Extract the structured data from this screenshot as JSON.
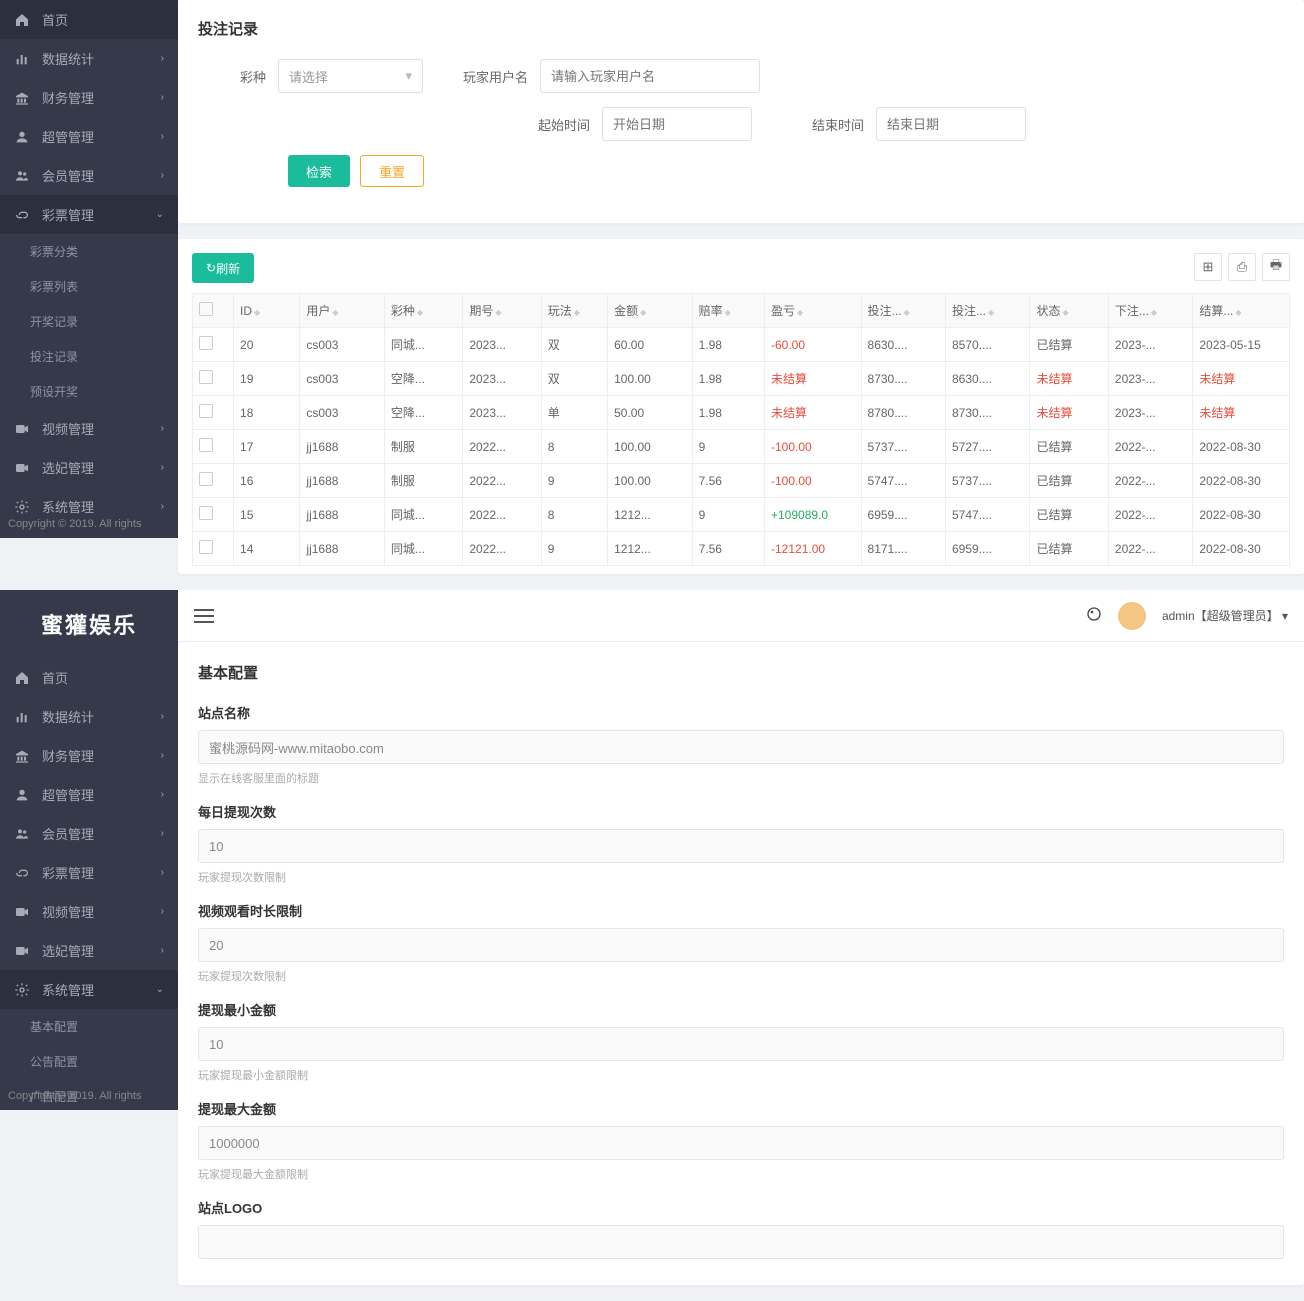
{
  "brand": "蜜獾娱乐",
  "copyright": "Copyright © 2019. All rights",
  "sidebar1": {
    "items": [
      {
        "label": "首页",
        "icon": "home",
        "expand": false
      },
      {
        "label": "数据统计",
        "icon": "bars",
        "expand": true
      },
      {
        "label": "财务管理",
        "icon": "bank",
        "expand": true
      },
      {
        "label": "超管管理",
        "icon": "user",
        "expand": true
      },
      {
        "label": "会员管理",
        "icon": "users",
        "expand": true
      },
      {
        "label": "彩票管理",
        "icon": "link",
        "expand": true,
        "open": true,
        "subs": [
          "彩票分类",
          "彩票列表",
          "开奖记录",
          "投注记录",
          "预设开奖"
        ]
      },
      {
        "label": "视频管理",
        "icon": "video",
        "expand": true
      },
      {
        "label": "选妃管理",
        "icon": "video",
        "expand": true
      },
      {
        "label": "系统管理",
        "icon": "gear",
        "expand": true
      }
    ]
  },
  "sidebar2": {
    "items": [
      {
        "label": "首页",
        "icon": "home",
        "expand": false
      },
      {
        "label": "数据统计",
        "icon": "bars",
        "expand": true
      },
      {
        "label": "财务管理",
        "icon": "bank",
        "expand": true
      },
      {
        "label": "超管管理",
        "icon": "user",
        "expand": true
      },
      {
        "label": "会员管理",
        "icon": "users",
        "expand": true
      },
      {
        "label": "彩票管理",
        "icon": "link",
        "expand": true
      },
      {
        "label": "视频管理",
        "icon": "video",
        "expand": true
      },
      {
        "label": "选妃管理",
        "icon": "video",
        "expand": true
      },
      {
        "label": "系统管理",
        "icon": "gear",
        "expand": true,
        "open": true,
        "subs": [
          "基本配置",
          "公告配置",
          "广告配置"
        ]
      }
    ]
  },
  "betting": {
    "title": "投注记录",
    "labels": {
      "type": "彩种",
      "typePlaceholder": "请选择",
      "user": "玩家用户名",
      "userPlaceholder": "请输入玩家用户名",
      "start": "起始时间",
      "startPlaceholder": "开始日期",
      "end": "结束时间",
      "endPlaceholder": "结束日期"
    },
    "btnSearch": "检索",
    "btnReset": "重置",
    "btnRefresh": "刷新",
    "columns": [
      "",
      "ID",
      "用户",
      "彩种",
      "期号",
      "玩法",
      "金额",
      "赔率",
      "盈亏",
      "投注...",
      "投注...",
      "状态",
      "下注...",
      "结算..."
    ],
    "rows": [
      {
        "id": "20",
        "user": "cs003",
        "type": "同城...",
        "period": "2023...",
        "play": "双",
        "amount": "60.00",
        "odds": "1.98",
        "profit": "-60.00",
        "bet1": "8630....",
        "bet2": "8570....",
        "status": "已结算",
        "time1": "2023-...",
        "time2": "2023-05-15"
      },
      {
        "id": "19",
        "user": "cs003",
        "type": "空降...",
        "period": "2023...",
        "play": "双",
        "amount": "100.00",
        "odds": "1.98",
        "profit": "未结算",
        "bet1": "8730....",
        "bet2": "8630....",
        "status": "未结算",
        "time1": "2023-...",
        "time2": "未结算"
      },
      {
        "id": "18",
        "user": "cs003",
        "type": "空降...",
        "period": "2023...",
        "play": "单",
        "amount": "50.00",
        "odds": "1.98",
        "profit": "未结算",
        "bet1": "8780....",
        "bet2": "8730....",
        "status": "未结算",
        "time1": "2023-...",
        "time2": "未结算"
      },
      {
        "id": "17",
        "user": "jj1688",
        "type": "制服",
        "period": "2022...",
        "play": "8",
        "amount": "100.00",
        "odds": "9",
        "profit": "-100.00",
        "bet1": "5737....",
        "bet2": "5727....",
        "status": "已结算",
        "time1": "2022-...",
        "time2": "2022-08-30"
      },
      {
        "id": "16",
        "user": "jj1688",
        "type": "制服",
        "period": "2022...",
        "play": "9",
        "amount": "100.00",
        "odds": "7.56",
        "profit": "-100.00",
        "bet1": "5747....",
        "bet2": "5737....",
        "status": "已结算",
        "time1": "2022-...",
        "time2": "2022-08-30"
      },
      {
        "id": "15",
        "user": "jj1688",
        "type": "同城...",
        "period": "2022...",
        "play": "8",
        "amount": "1212...",
        "odds": "9",
        "profit": "+109089.0",
        "bet1": "6959....",
        "bet2": "5747....",
        "status": "已结算",
        "time1": "2022-...",
        "time2": "2022-08-30"
      },
      {
        "id": "14",
        "user": "jj1688",
        "type": "同城...",
        "period": "2022...",
        "play": "9",
        "amount": "1212...",
        "odds": "7.56",
        "profit": "-12121.00",
        "bet1": "8171....",
        "bet2": "6959....",
        "status": "已结算",
        "time1": "2022-...",
        "time2": "2022-08-30"
      }
    ]
  },
  "topbar": {
    "userName": "admin【超级管理员】"
  },
  "config": {
    "title": "基本配置",
    "fields": [
      {
        "label": "站点名称",
        "value": "蜜桃源码网-www.mitaobo.com",
        "hint": "显示在线客服里面的标题"
      },
      {
        "label": "每日提现次数",
        "value": "10",
        "hint": "玩家提现次数限制"
      },
      {
        "label": "视频观看时长限制",
        "value": "20",
        "hint": "玩家提现次数限制"
      },
      {
        "label": "提现最小金额",
        "value": "10",
        "hint": "玩家提现最小金额限制"
      },
      {
        "label": "提现最大金额",
        "value": "1000000",
        "hint": "玩家提现最大金额限制"
      },
      {
        "label": "站点LOGO",
        "value": "",
        "hint": ""
      }
    ]
  }
}
